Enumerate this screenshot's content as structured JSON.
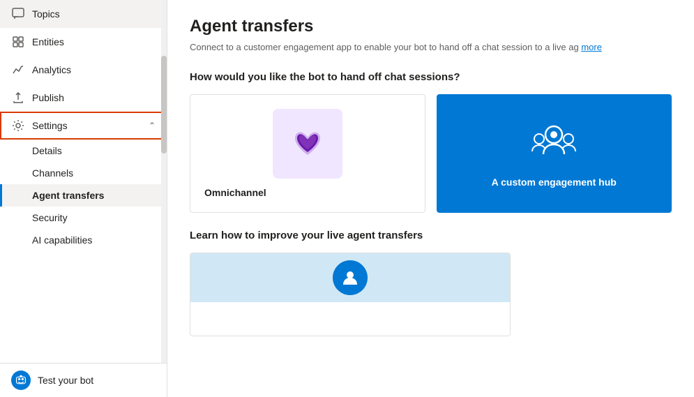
{
  "sidebar": {
    "items": [
      {
        "id": "topics",
        "label": "Topics",
        "icon": "chat-icon"
      },
      {
        "id": "entities",
        "label": "Entities",
        "icon": "entities-icon"
      },
      {
        "id": "analytics",
        "label": "Analytics",
        "icon": "analytics-icon"
      },
      {
        "id": "publish",
        "label": "Publish",
        "icon": "publish-icon"
      },
      {
        "id": "settings",
        "label": "Settings",
        "icon": "settings-icon",
        "expanded": true,
        "hasChevron": true
      }
    ],
    "sub_items": [
      {
        "id": "details",
        "label": "Details",
        "active": false
      },
      {
        "id": "channels",
        "label": "Channels",
        "active": false
      },
      {
        "id": "agent-transfers",
        "label": "Agent transfers",
        "active": true
      },
      {
        "id": "security",
        "label": "Security",
        "active": false
      },
      {
        "id": "ai-capabilities",
        "label": "AI capabilities",
        "active": false
      }
    ],
    "bottom_item": {
      "label": "Test your bot",
      "icon": "robot-icon"
    }
  },
  "main": {
    "page_title": "Agent transfers",
    "subtitle": "Connect to a customer engagement app to enable your bot to hand off a chat session to a live ag",
    "subtitle_link": "more",
    "section1_title": "How would you like the bot to hand off chat sessions?",
    "card1_label": "Omnichannel",
    "card2_label": "A custom engagement hub",
    "section2_title": "Learn how to improve your live agent transfers"
  }
}
